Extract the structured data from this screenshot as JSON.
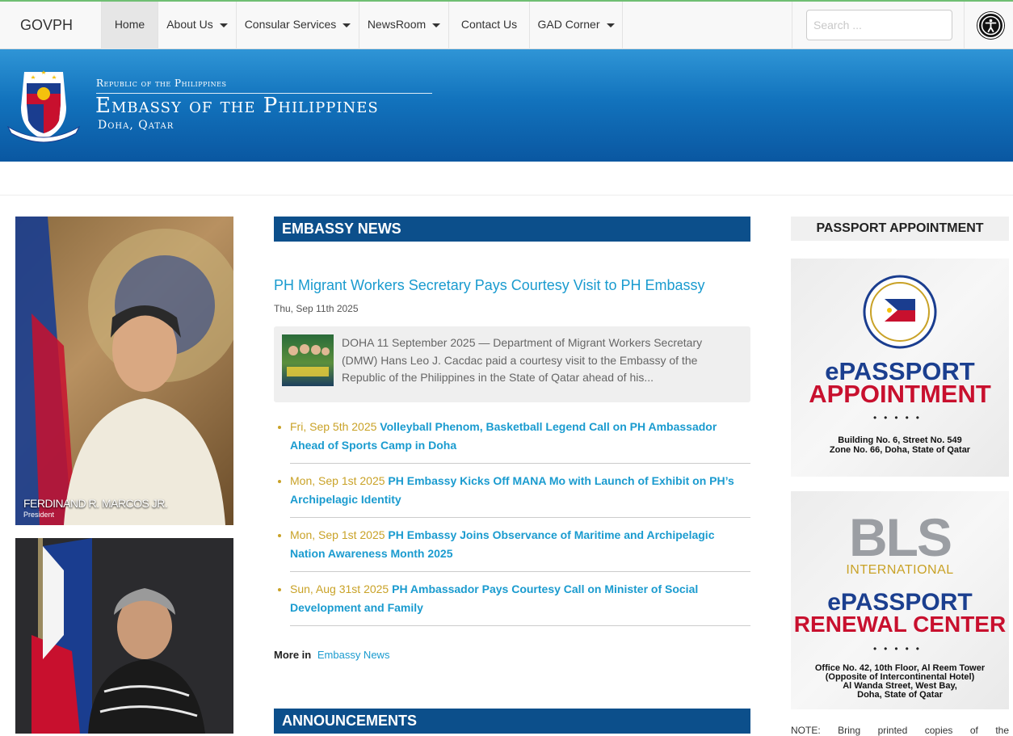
{
  "nav": {
    "brand": "GOVPH",
    "items": [
      {
        "label": "Home"
      },
      {
        "label": "About Us"
      },
      {
        "label": "Consular Services"
      },
      {
        "label": "NewsRoom"
      },
      {
        "label": "Contact Us"
      },
      {
        "label": "GAD Corner"
      }
    ],
    "search_placeholder": "Search ...",
    "accessibility_icon": "accessibility-icon"
  },
  "banner": {
    "small_title": "Republic of the Philippines",
    "main_title": "Embassy of the Philippines",
    "city": "Doha, Qatar",
    "seal_icon": "philippine-seal-icon"
  },
  "portraits": [
    {
      "name": "FERDINAND R. MARCOS JR.",
      "role": "President"
    },
    {
      "name": "",
      "role": ""
    }
  ],
  "embassy_news": {
    "heading": "EMBASSY NEWS",
    "featured": {
      "title": "PH Migrant Workers Secretary Pays Courtesy Visit to PH Embassy",
      "date": "Thu, Sep 11th 2025",
      "excerpt": "DOHA 11 September 2025 — Department of Migrant Workers Secretary (DMW) Hans Leo J. Cacdac paid a courtesy visit to the Embassy of the Republic of the Philippines in the State of Qatar ahead of his..."
    },
    "items": [
      {
        "date": "Fri, Sep 5th 2025",
        "title": "Volleyball Phenom, Basketball Legend Call on PH Ambassador Ahead of Sports Camp in Doha"
      },
      {
        "date": "Mon, Sep 1st 2025",
        "title": "PH Embassy Kicks Off MANA Mo with Launch of Exhibit on PH’s Archipelagic Identity"
      },
      {
        "date": "Mon, Sep 1st 2025",
        "title": "PH Embassy Joins Observance of Maritime and Archipelagic Nation Awareness Month 2025"
      },
      {
        "date": "Sun, Aug 31st 2025",
        "title": "PH Ambassador Pays Courtesy Call on Minister of Social Development and Family"
      }
    ],
    "more_label": "More in",
    "more_link": "Embassy News"
  },
  "announcements": {
    "heading": "ANNOUNCEMENTS"
  },
  "sidebar": {
    "heading": "PASSPORT APPOINTMENT",
    "promo1": {
      "line1": "ePASSPORT",
      "line2": "APPOINTMENT",
      "dots": "•••••",
      "addr1": "Building No. 6, Street No. 549",
      "addr2": "Zone No. 66, Doha, State of Qatar"
    },
    "promo2": {
      "logo": "BLS",
      "logo_sub": "INTERNATIONAL",
      "line1": "ePASSPORT",
      "line2": "RENEWAL CENTER",
      "dots": "•••••",
      "addr1": "Office No. 42, 10th Floor, Al Reem Tower",
      "addr2": "(Opposite of Intercontinental Hotel)",
      "addr3": "Al Wanda Street, West Bay,",
      "addr4": "Doha, State of Qatar"
    },
    "note": "NOTE: Bring printed copies of the"
  },
  "colors": {
    "accent_blue": "#1a9bcf",
    "header_navy": "#0c4f8b",
    "date_gold": "#c9a227",
    "banner_blue": "#1273bd"
  }
}
